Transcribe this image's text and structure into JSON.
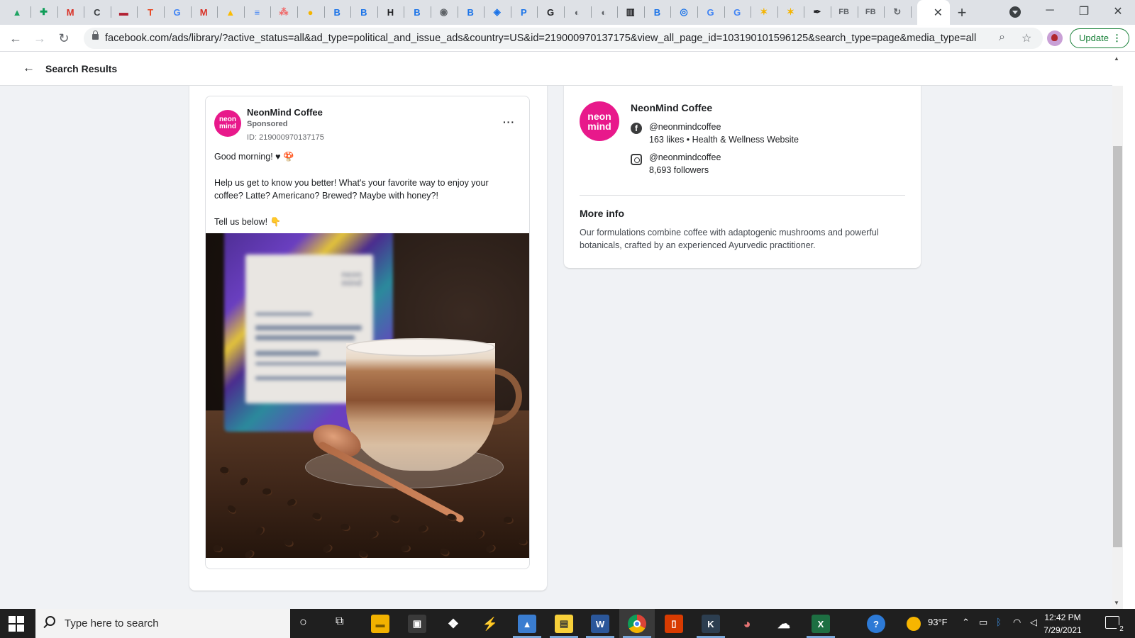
{
  "browser": {
    "tabs": [
      {
        "icon": "google-drive-icon",
        "glyph": "▲",
        "color": "#1fa463"
      },
      {
        "icon": "google-sheets-icon",
        "glyph": "✚",
        "color": "#0f9d58"
      },
      {
        "icon": "gmail-icon",
        "glyph": "M",
        "color": "#d93025"
      },
      {
        "icon": "cc-icon",
        "glyph": "C",
        "color": "#3c4043"
      },
      {
        "icon": "flag-icon",
        "glyph": "▬",
        "color": "#b22234"
      },
      {
        "icon": "t-icon",
        "glyph": "T",
        "color": "#e8431c"
      },
      {
        "icon": "google-icon",
        "glyph": "G",
        "color": "#4285f4"
      },
      {
        "icon": "gmail-icon",
        "glyph": "M",
        "color": "#d93025"
      },
      {
        "icon": "google-drive-icon",
        "glyph": "▲",
        "color": "#fbbc04"
      },
      {
        "icon": "google-docs-icon",
        "glyph": "≡",
        "color": "#4285f4"
      },
      {
        "icon": "asana-icon",
        "glyph": "⁂",
        "color": "#f06a6a"
      },
      {
        "icon": "cloud-icon",
        "glyph": "●",
        "color": "#f4b400"
      },
      {
        "icon": "b-icon",
        "glyph": "B",
        "color": "#1a73e8"
      },
      {
        "icon": "b-icon",
        "glyph": "B",
        "color": "#1a73e8"
      },
      {
        "icon": "h-icon",
        "glyph": "H",
        "color": "#202124"
      },
      {
        "icon": "b-icon",
        "glyph": "B",
        "color": "#1a73e8"
      },
      {
        "icon": "owl-icon",
        "glyph": "◉",
        "color": "#5f6368"
      },
      {
        "icon": "b-icon",
        "glyph": "B",
        "color": "#1a73e8"
      },
      {
        "icon": "shield-icon",
        "glyph": "◈",
        "color": "#1a73e8"
      },
      {
        "icon": "p-icon",
        "glyph": "P",
        "color": "#1a73e8"
      },
      {
        "icon": "g-box-icon",
        "glyph": "G",
        "color": "#202124"
      },
      {
        "icon": "globe-icon",
        "glyph": "◐",
        "color": "#5f6368"
      },
      {
        "icon": "globe-icon",
        "glyph": "◐",
        "color": "#5f6368"
      },
      {
        "icon": "barcode-icon",
        "glyph": "▥",
        "color": "#202124"
      },
      {
        "icon": "b-icon",
        "glyph": "B",
        "color": "#1a73e8"
      },
      {
        "icon": "circle-e-icon",
        "glyph": "◎",
        "color": "#1a73e8"
      },
      {
        "icon": "google-icon",
        "glyph": "G",
        "color": "#4285f4"
      },
      {
        "icon": "google-icon",
        "glyph": "G",
        "color": "#4285f4"
      },
      {
        "icon": "star-icon",
        "glyph": "✶",
        "color": "#f4b400"
      },
      {
        "icon": "star-icon",
        "glyph": "✶",
        "color": "#f4b400"
      },
      {
        "icon": "pen-icon",
        "glyph": "✒",
        "color": "#202124"
      },
      {
        "icon": "fb-text-icon",
        "glyph": "FB",
        "color": "#5f6368"
      },
      {
        "icon": "fb-text-icon",
        "glyph": "FB",
        "color": "#5f6368"
      },
      {
        "icon": "refresh-circle-icon",
        "glyph": "↻",
        "color": "#5f6368"
      }
    ],
    "active_tab_close": "✕",
    "new_tab": "+",
    "url": "facebook.com/ads/library/?active_status=all&ad_type=political_and_issue_ads&country=US&id=219000970137175&view_all_page_id=103190101596125&search_type=page&media_type=all",
    "update_label": "Update",
    "update_menu": "⋮"
  },
  "header": {
    "back": "←",
    "title": "Search Results"
  },
  "ad": {
    "page_name": "NeonMind Coffee",
    "logo_top": "neon",
    "logo_bottom": "mind",
    "sponsored": "Sponsored",
    "id_text": "ID: 219000970137175",
    "menu": "···",
    "body": [
      "Good morning! ♥ 🍄",
      "Help us get to know you better! What's your favorite way to enjoy your coffee? Latte? Americano? Brewed? Maybe with honey?!",
      "Tell us below! 👇"
    ],
    "bag_brand_top": "neon",
    "bag_brand_bottom": "mind"
  },
  "page_info": {
    "name": "NeonMind Coffee",
    "logo_top": "neon",
    "logo_bottom": "mind",
    "facebook_handle": "@neonmindcoffee",
    "facebook_stats": "163 likes • Health & Wellness Website",
    "instagram_handle": "@neonmindcoffee",
    "instagram_stats": "8,693 followers",
    "more_info_title": "More info",
    "more_info_text": "Our formulations combine coffee with adaptogenic mushrooms and powerful botanicals, crafted by an experienced Ayurvedic practitioner."
  },
  "taskbar": {
    "search_placeholder": "Type here to search",
    "temperature": "93°F",
    "time": "12:42 PM",
    "date": "7/29/2021",
    "notifications": "2"
  }
}
